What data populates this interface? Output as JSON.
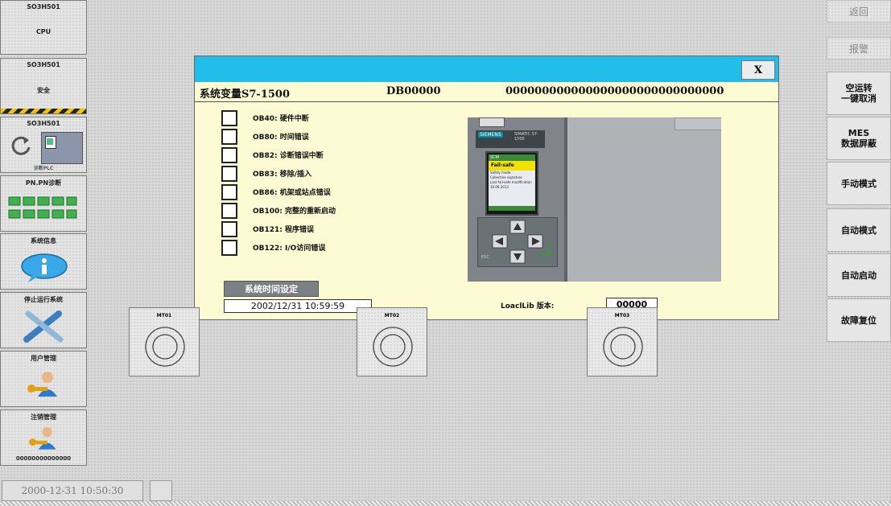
{
  "left_panel": [
    {
      "title": "SO3H501",
      "label": "CPU"
    },
    {
      "title": "SO3H501",
      "label": "安全"
    },
    {
      "title": "SO3H501",
      "label": "诊断PLC"
    },
    {
      "title": "PN.PN诊断",
      "label": ""
    },
    {
      "title": "系统信息",
      "label": ""
    },
    {
      "title": "停止运行系统",
      "label": ""
    },
    {
      "title": "用户管理",
      "label": ""
    },
    {
      "title": "注销管理",
      "label": "00000000000000"
    }
  ],
  "right_panel": {
    "top_buttons": [
      "返回",
      "报警"
    ],
    "buttons": [
      "空运转\n一键取消",
      "MES\n数据屏蔽",
      "手动模式",
      "自动模式",
      "自动启动",
      "故障复位"
    ]
  },
  "dialog": {
    "close_label": "X",
    "header_title": "系统变量S7-1500",
    "header_db": "DB00000",
    "header_value": "000000000000000000000000000000",
    "checkbox_items": [
      "OB40: 硬件中断",
      "OB80: 时间错误",
      "OB82: 诊断错误中断",
      "OB83: 移除/插入",
      "OB86: 机架或站点错误",
      "OB100: 完整的重新启动",
      "OB121: 程序错误",
      "OB122: I/O访问错误"
    ],
    "time_button": "系统时间设定",
    "time_value": "2002/12/31 10:59:59",
    "lib_label": "LoaclLib 版本:",
    "lib_value": "00000"
  },
  "plc_display": {
    "brand": "SIEMENS",
    "model": "SIMATIC S7-1500",
    "screen_header": "SCM",
    "screen_title": "Fail-safe",
    "screen_lines": [
      "Safety mode",
      "Collective signature",
      "Last fail-safe modification",
      "30.09.2013"
    ],
    "button_label": "ESC"
  },
  "modules": [
    "MT01",
    "MT02",
    "MT03"
  ],
  "status_bar": {
    "datetime": "2000-12-31 10:50:30"
  }
}
